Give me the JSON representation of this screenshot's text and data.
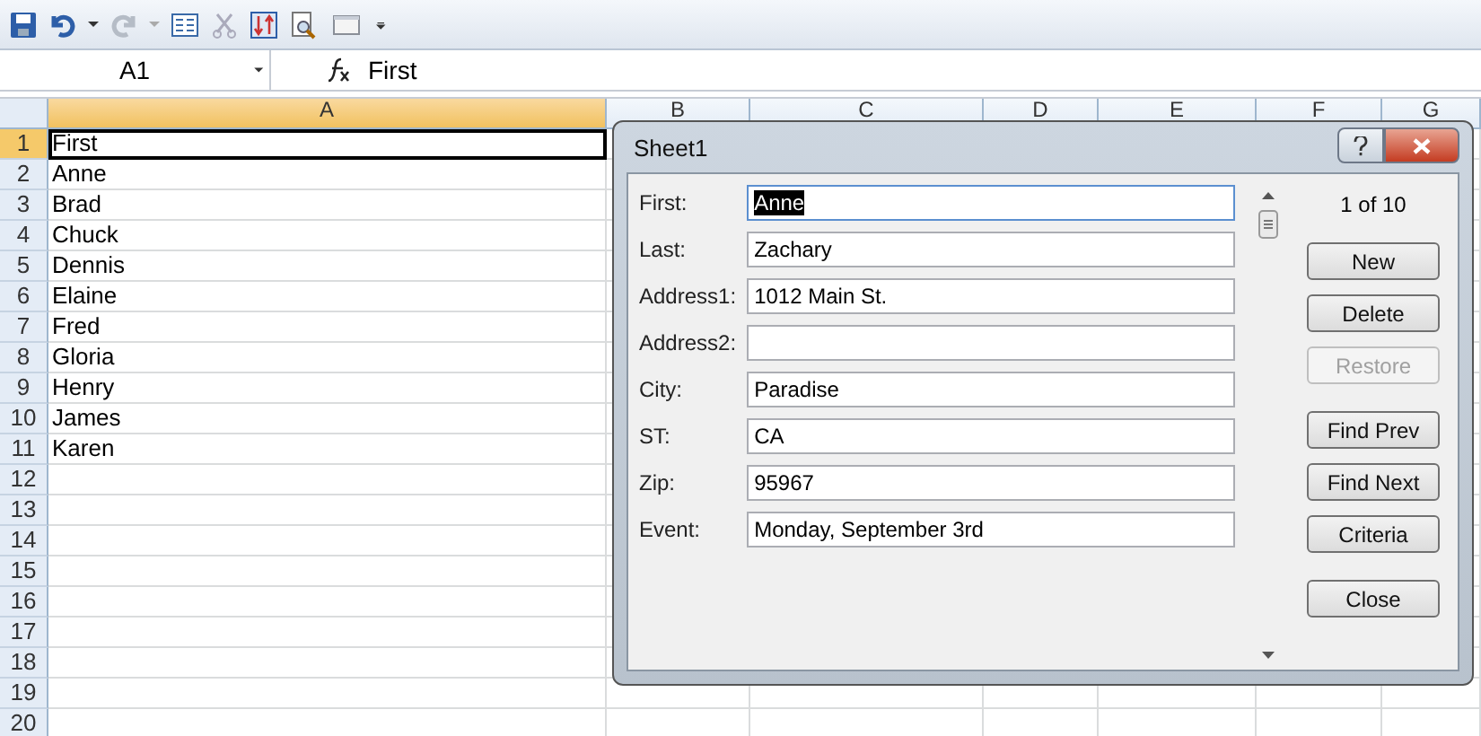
{
  "name_box": "A1",
  "formula": "First",
  "columns": [
    {
      "label": "A",
      "selected": true
    },
    {
      "label": "B",
      "selected": false
    },
    {
      "label": "C",
      "selected": false
    },
    {
      "label": "D",
      "selected": false
    },
    {
      "label": "E",
      "selected": false
    },
    {
      "label": "F",
      "selected": false
    },
    {
      "label": "G",
      "selected": false
    }
  ],
  "rows": [
    {
      "number": "1",
      "value": "First",
      "selected": true
    },
    {
      "number": "2",
      "value": "Anne",
      "selected": false
    },
    {
      "number": "3",
      "value": "Brad",
      "selected": false
    },
    {
      "number": "4",
      "value": "Chuck",
      "selected": false
    },
    {
      "number": "5",
      "value": "Dennis",
      "selected": false
    },
    {
      "number": "6",
      "value": "Elaine",
      "selected": false
    },
    {
      "number": "7",
      "value": "Fred",
      "selected": false
    },
    {
      "number": "8",
      "value": "Gloria",
      "selected": false
    },
    {
      "number": "9",
      "value": "Henry",
      "selected": false
    },
    {
      "number": "10",
      "value": "James",
      "selected": false
    },
    {
      "number": "11",
      "value": "Karen",
      "selected": false
    },
    {
      "number": "12",
      "selected": false
    },
    {
      "number": "13",
      "selected": false
    },
    {
      "number": "14",
      "selected": false
    },
    {
      "number": "15",
      "selected": false
    },
    {
      "number": "16",
      "selected": false
    },
    {
      "number": "17",
      "selected": false
    },
    {
      "number": "18",
      "selected": false
    },
    {
      "number": "19",
      "selected": false
    },
    {
      "number": "20",
      "selected": false
    }
  ],
  "dialog": {
    "title": "Sheet1",
    "record": "1 of 10",
    "fields": [
      {
        "label": "First:",
        "value": "Anne",
        "selected": true
      },
      {
        "label": "Last:",
        "value": "Zachary",
        "selected": false
      },
      {
        "label": "Address1:",
        "value": "1012 Main St.",
        "selected": false
      },
      {
        "label": "Address2:",
        "selected": false
      },
      {
        "label": "City:",
        "value": "Paradise",
        "selected": false
      },
      {
        "label": "ST:",
        "value": "CA",
        "selected": false
      },
      {
        "label": "Zip:",
        "value": "95967",
        "selected": false
      },
      {
        "label": "Event:",
        "value": "Monday, September 3rd",
        "selected": false
      }
    ],
    "button_groups": [
      [
        {
          "label": "New",
          "disabled": false
        },
        {
          "label": "Delete",
          "disabled": false
        },
        {
          "label": "Restore",
          "disabled": true
        }
      ],
      [
        {
          "label": "Find Prev",
          "disabled": false
        },
        {
          "label": "Find Next",
          "disabled": false
        },
        {
          "label": "Criteria",
          "disabled": false
        }
      ],
      [
        {
          "label": "Close",
          "disabled": false
        }
      ]
    ]
  }
}
